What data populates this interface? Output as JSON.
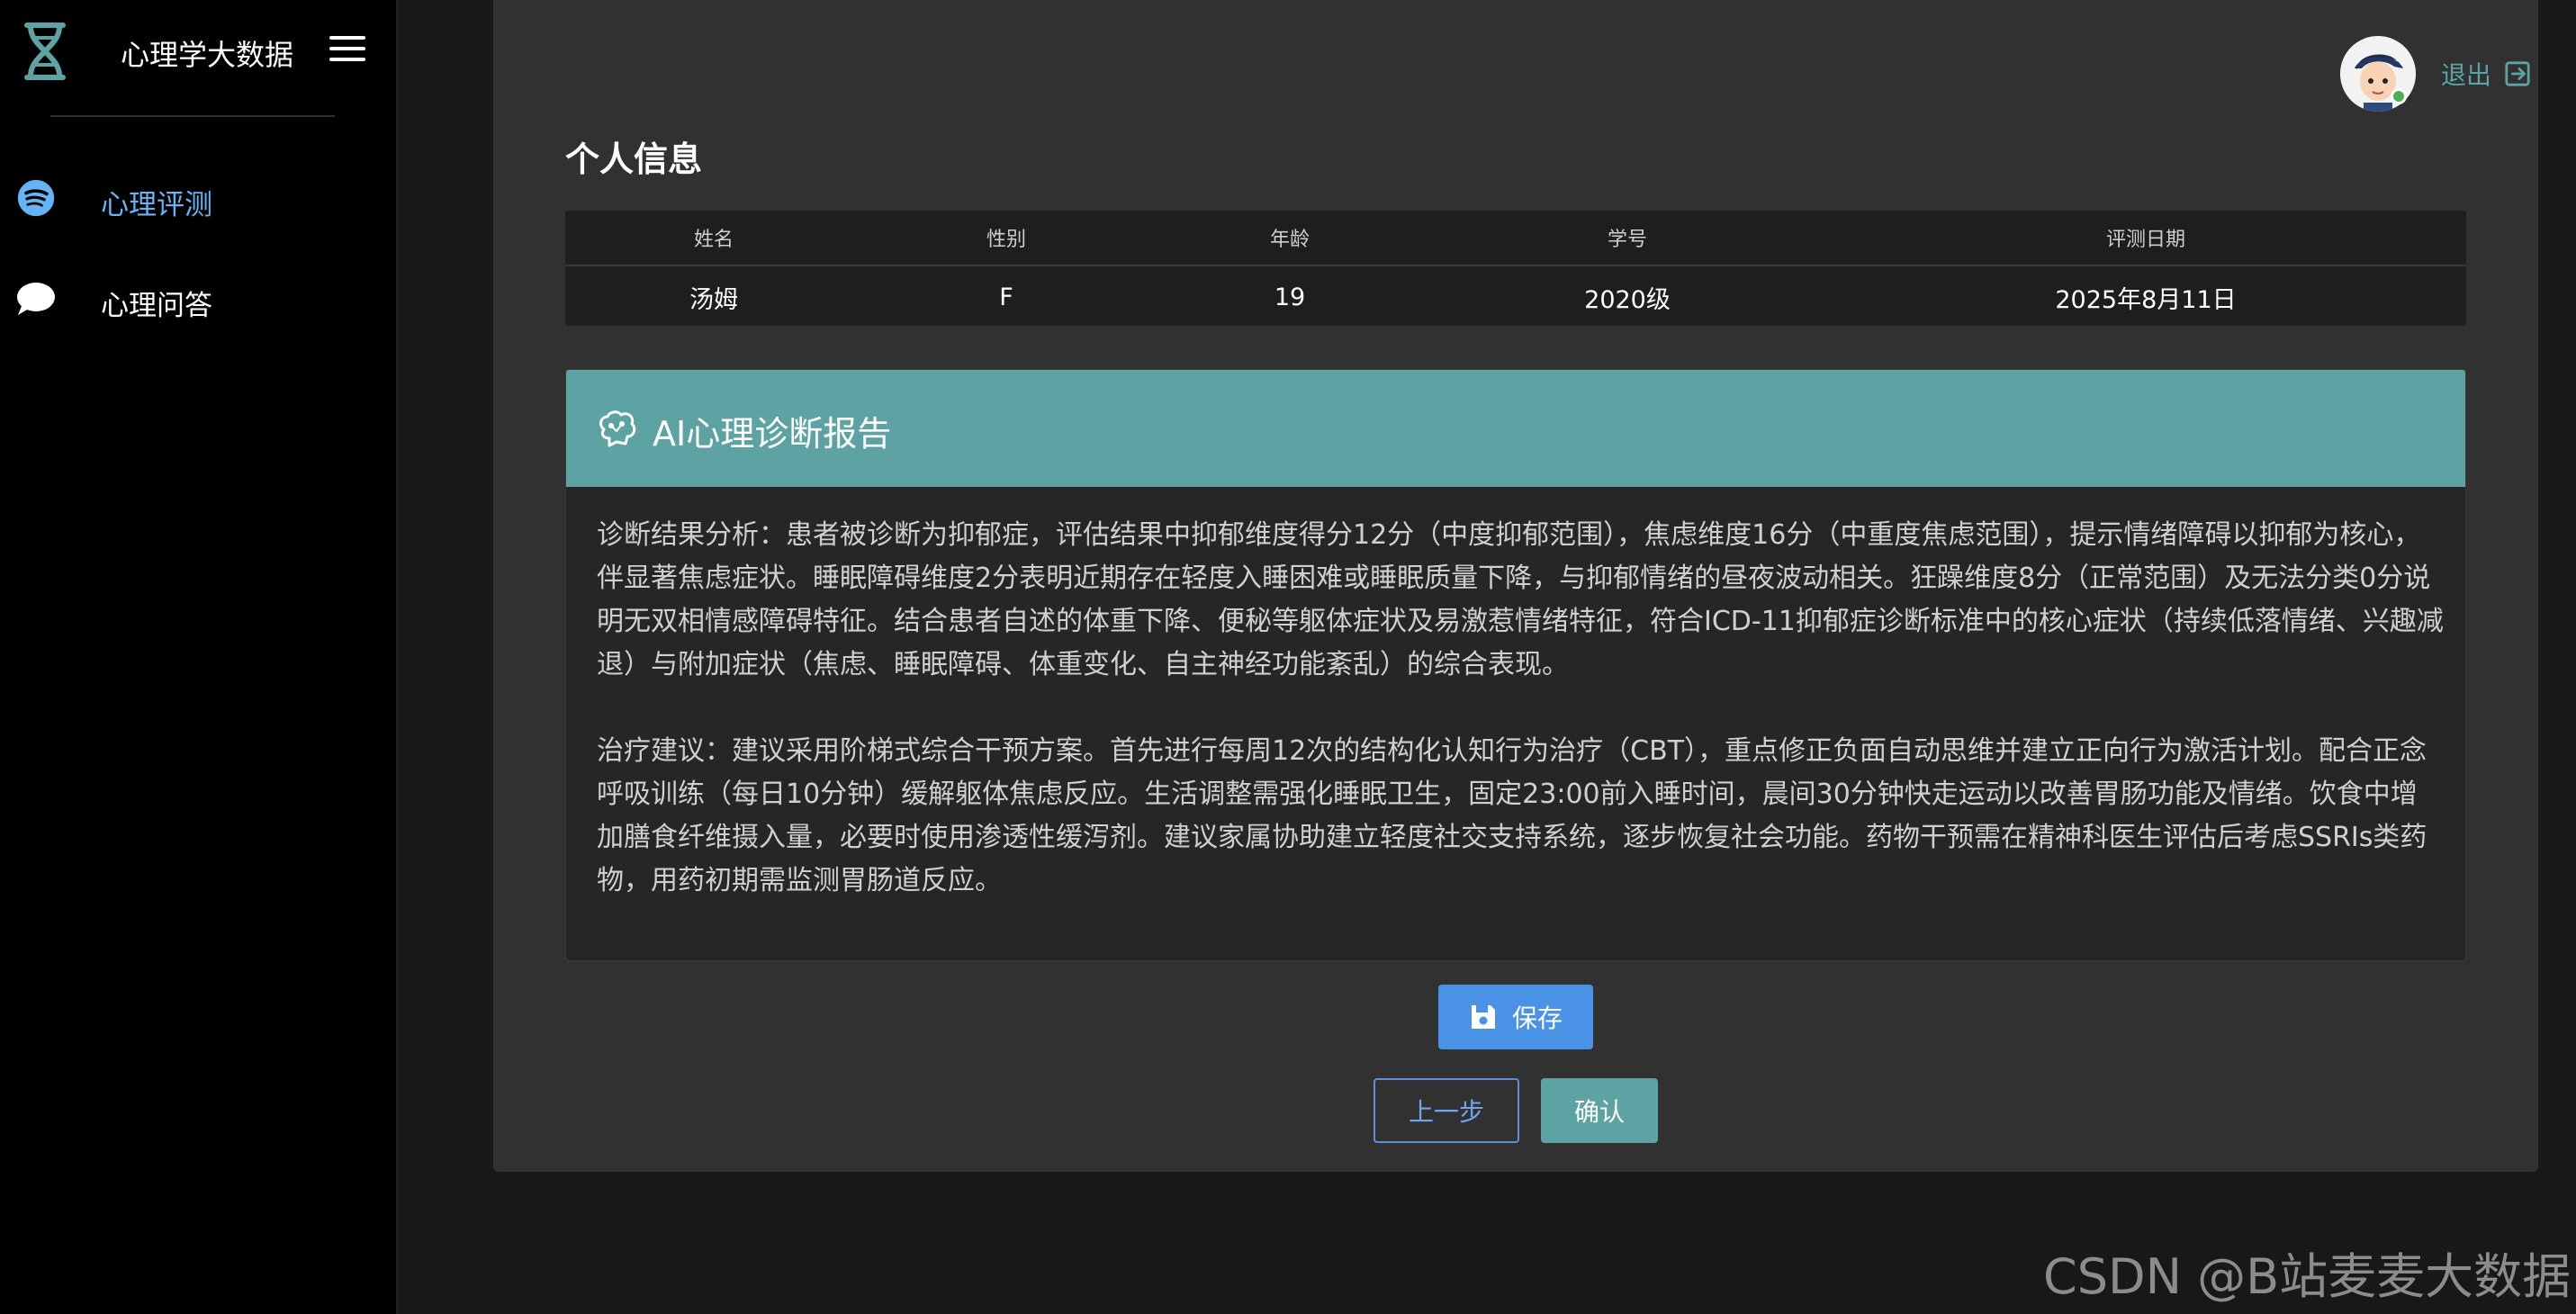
{
  "sidebar": {
    "brand_title": "心理学大数据",
    "items": [
      {
        "label": "心理评测",
        "icon": "spotify-circle-icon",
        "active": true
      },
      {
        "label": "心理问答",
        "icon": "chat-bubble-icon",
        "active": false
      }
    ]
  },
  "header": {
    "logout_label": "退出"
  },
  "info": {
    "title": "个人信息",
    "columns": [
      "姓名",
      "性别",
      "年龄",
      "学号",
      "评测日期"
    ],
    "row": [
      "汤姆",
      "F",
      "19",
      "2020级",
      "2025年8月11日"
    ]
  },
  "report": {
    "title": "AI心理诊断报告",
    "paragraphs": [
      "诊断结果分析：患者被诊断为抑郁症，评估结果中抑郁维度得分12分（中度抑郁范围），焦虑维度16分（中重度焦虑范围），提示情绪障碍以抑郁为核心，伴显著焦虑症状。睡眠障碍维度2分表明近期存在轻度入睡困难或睡眠质量下降，与抑郁情绪的昼夜波动相关。狂躁维度8分（正常范围）及无法分类0分说明无双相情感障碍特征。结合患者自述的体重下降、便秘等躯体症状及易激惹情绪特征，符合ICD-11抑郁症诊断标准中的核心症状（持续低落情绪、兴趣减退）与附加症状（焦虑、睡眠障碍、体重变化、自主神经功能紊乱）的综合表现。",
      "治疗建议：建议采用阶梯式综合干预方案。首先进行每周12次的结构化认知行为治疗（CBT），重点修正负面自动思维并建立正向行为激活计划。配合正念呼吸训练（每日10分钟）缓解躯体焦虑反应。生活调整需强化睡眠卫生，固定23:00前入睡时间，晨间30分钟快走运动以改善胃肠功能及情绪。饮食中增加膳食纤维摄入量，必要时使用渗透性缓泻剂。建议家属协助建立轻度社交支持系统，逐步恢复社会功能。药物干预需在精神科医生评估后考虑SSRIs类药物，用药初期需监测胃肠道反应。"
    ]
  },
  "actions": {
    "save_label": "保存",
    "prev_label": "上一步",
    "confirm_label": "确认"
  },
  "watermark": "CSDN @B站麦麦大数据",
  "colors": {
    "accent_teal": "#5ea3a3",
    "primary_blue": "#4a92e6",
    "active_nav": "#64b5f6"
  }
}
